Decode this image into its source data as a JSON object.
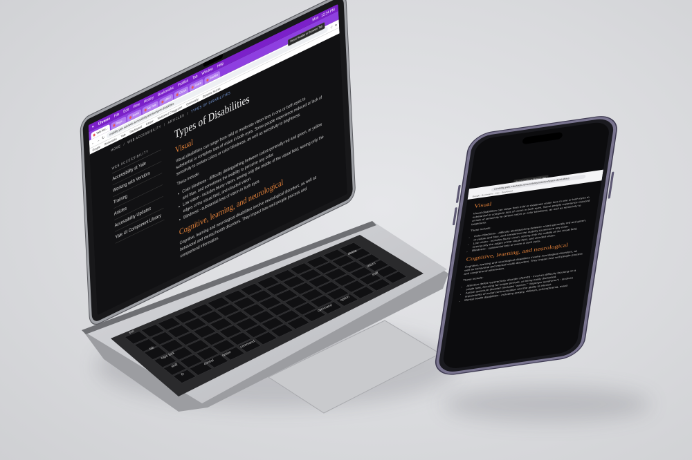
{
  "browser": {
    "menubar": {
      "app": "Chrome",
      "items": [
        "File",
        "Edit",
        "View",
        "History",
        "Bookmarks",
        "Profiles",
        "Tab",
        "Window",
        "Help"
      ],
      "right": [
        "Mon",
        "12:34 PM"
      ]
    },
    "tabs": [
      "Yale Acc...",
      "Regis...",
      "Home",
      "My Yale",
      "pREV",
      "Canva",
      "Share",
      "Dashbo"
    ],
    "url": "usability.yale.edu/web-accessibility/articles/types-disabilities",
    "bookmarks": [
      "Google",
      "Bookmarks",
      "Yale",
      "Dashboard",
      "Career",
      "Welcome | Chegg.com",
      "Grammarly",
      "Dynamic Scores"
    ],
    "tooltip": "Reset Header or Browser Tab"
  },
  "page": {
    "breadcrumb": {
      "home": "HOME",
      "section": "WEB ACCESSIBILITY",
      "sub": "ARTICLES",
      "current": "TYPES OF DISABILITIES"
    },
    "sidenav": {
      "heading": "WEB ACCESSIBILITY",
      "items": [
        "Accessibility at Yale",
        "Working with Vendors",
        "Training",
        "Articles",
        "Accessibility Updates",
        "Yale UI Component Library"
      ]
    },
    "title": "Types of Disabilities",
    "visual": {
      "heading": "Visual",
      "intro": "Visual disabilities can range from mild or moderate vision loss in one or both eyes to substantial or complete loss of vision in both eyes. Some people experience reduced or lack of sensitivity to certain colors or color blindness, as well as sensitivity to brightness.",
      "these": "These include:",
      "items": [
        "Color blindness - difficulty distinguishing between colors generally red and green, or yellow and blue, and sometimes the inability to perceive any color.",
        "Low vision - includes blurry vision, seeing only the middle of the visual field, seeing only the edges of the visual field, and clouded vision.",
        "Blindness - substantial loss of vision in both eyes."
      ]
    },
    "cognitive": {
      "heading": "Cognitive, learning, and neurological",
      "intro": "Cognitive, learning and neurological disabilities involve neurological disorders, as well as behavioral and mental health disorders. They impact how well people process and comprehend information.",
      "these": "These include:",
      "items": [
        "Attention deficit hyperactivity disorder (ADHD) - involves difficulty focusing on a single task, focusing for longer periods, or being easily distracted.",
        "Autism spectrum disorder (includes \"autism,\" \"Asperger syndrome\") - involves impairments of social communication and the ability to interact.",
        "Mental health disabilities - including anxiety, delirium, schizophrenia, mood"
      ]
    }
  },
  "keyboard": {
    "keys": [
      "esc",
      "caps lock",
      "shift",
      "fn",
      "control",
      "option",
      "command",
      "return",
      "shift",
      "command",
      "option",
      "delete",
      "tab"
    ]
  },
  "colors": {
    "menubar": "#7b20c9",
    "tabbar": "#8e3fe0",
    "accent_heading": "#e2813a",
    "page_bg": "#111113",
    "device_silver": "#c7c8cc",
    "phone_frame": "#7a7590"
  }
}
